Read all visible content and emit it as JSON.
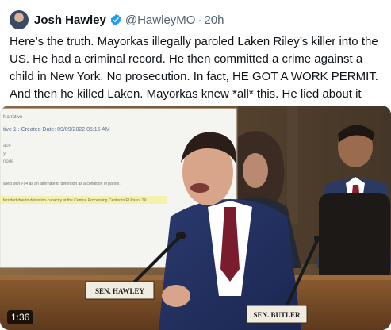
{
  "author": {
    "name": "Josh Hawley",
    "handle": "@HawleyMO",
    "separator": "·",
    "time": "20h"
  },
  "tweet_text": "Here’s the truth. Mayorkas illegally paroled Laken Riley’s killer into the\nUS. He had a criminal record. He then committed a crime against a\nchild in New York. No prosecution. In fact, HE GOT A WORK PERMIT.\nAnd then he killed Laken. Mayorkas knew *all* this. He lied about it",
  "media": {
    "document_lines": [
      "Narrative",
      "tive 1 : Created Date: 09/09/2022 05:15 AM",
      "ace",
      "y",
      "node",
      "ased with I-94 as an alternate to detention as a condition of parole.",
      "ferrided due to detention capacity at the Central Processing Center in El Paso, TX."
    ],
    "nameplate_primary": "SEN. HAWLEY",
    "nameplate_secondary": "SEN. BUTLER",
    "duration": "1:36"
  },
  "colors": {
    "verified": "#1d9bf0",
    "text": "#0f1419",
    "secondary_text": "#536471"
  }
}
